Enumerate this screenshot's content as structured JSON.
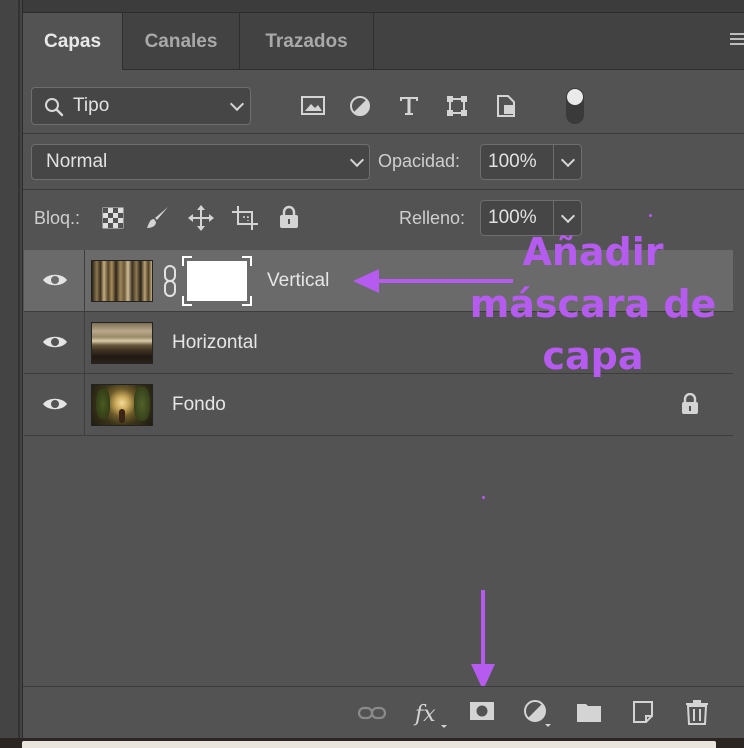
{
  "tabs": [
    {
      "label": "Capas"
    },
    {
      "label": "Canales"
    },
    {
      "label": "Trazados"
    }
  ],
  "filter": {
    "value": "Tipo"
  },
  "blend_mode": {
    "value": "Normal"
  },
  "opacity": {
    "label": "Opacidad:",
    "value": "100%"
  },
  "lock": {
    "label": "Bloq.:"
  },
  "fill": {
    "label": "Relleno:",
    "value": "100%"
  },
  "layers": [
    {
      "name": "Vertical",
      "selected": true,
      "has_mask": true,
      "locked": false
    },
    {
      "name": "Horizontal",
      "selected": false,
      "has_mask": false,
      "locked": false
    },
    {
      "name": "Fondo",
      "selected": false,
      "has_mask": false,
      "locked": true
    }
  ],
  "annotation": {
    "line1": "Añadir",
    "line2": "máscara de",
    "line3": "capa",
    "color": "#b65bf0"
  },
  "bottom_icons": [
    "link-layers-icon",
    "fx-icon",
    "add-mask-icon",
    "adjustment-layer-icon",
    "new-group-icon",
    "new-layer-icon",
    "delete-icon"
  ],
  "colors": {
    "panel": "#535353",
    "selected_layer": "#6a6a6a",
    "annotation": "#b65bf0"
  }
}
